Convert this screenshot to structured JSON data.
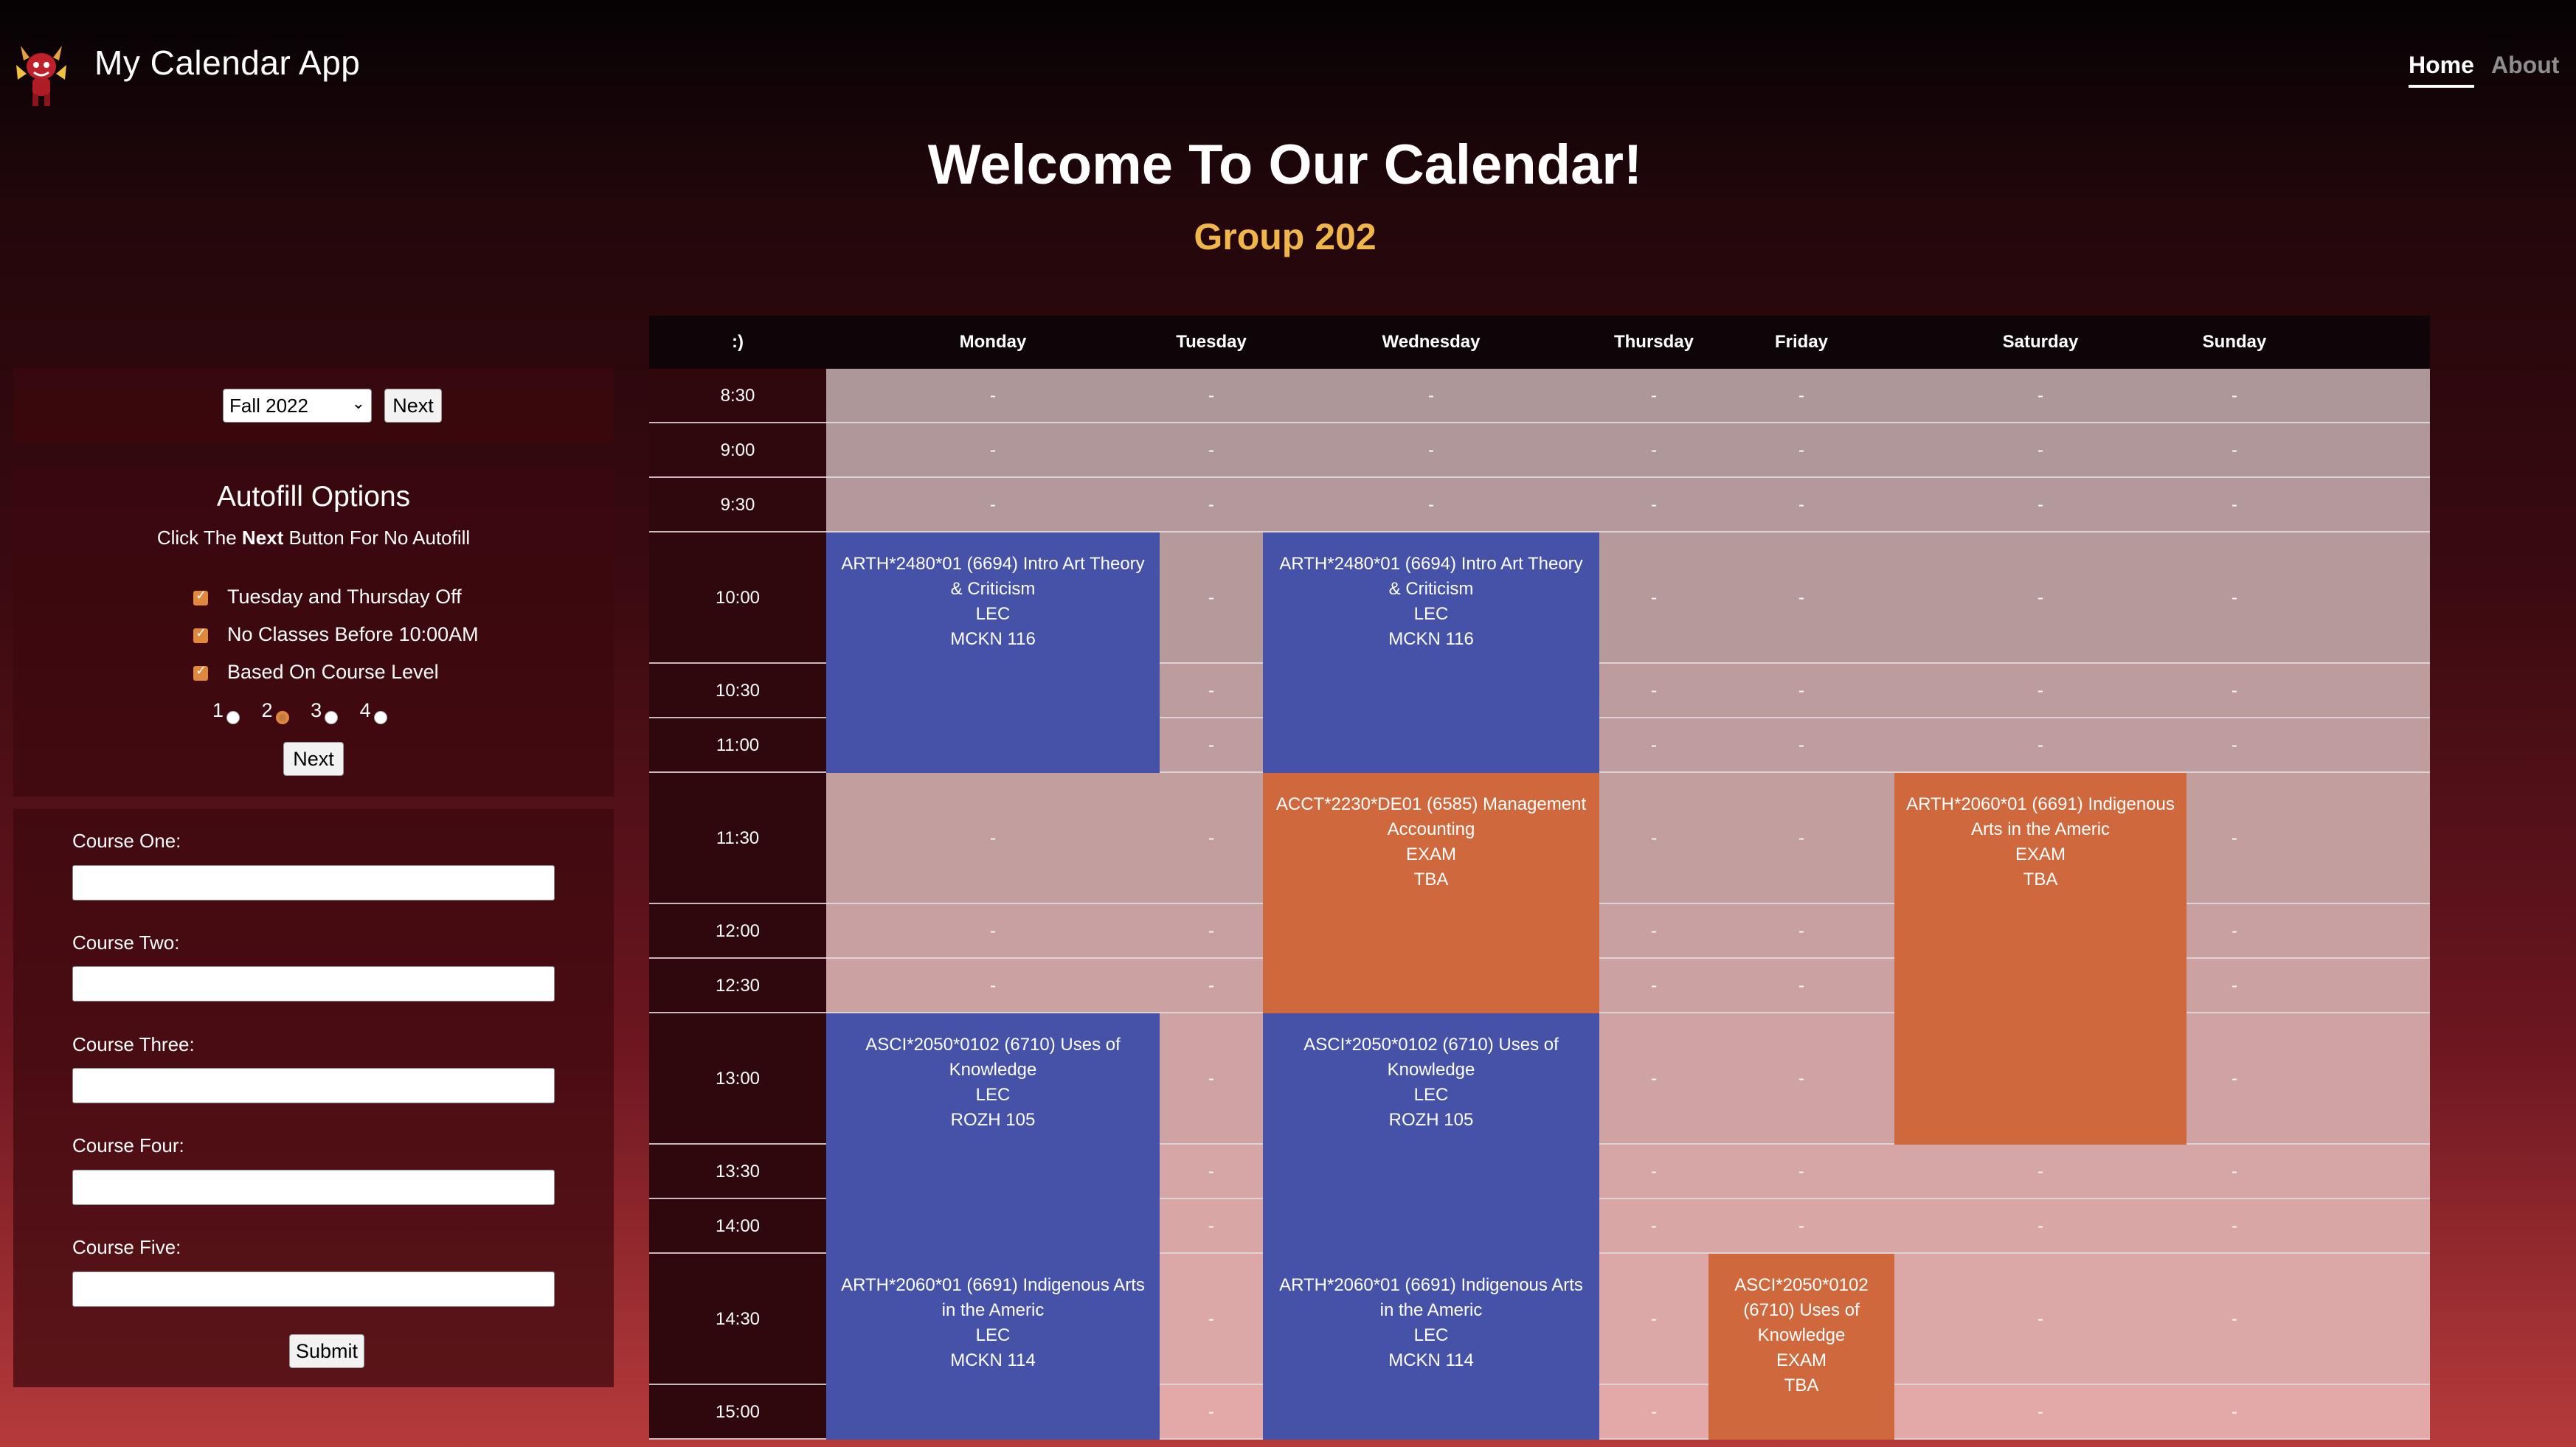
{
  "header": {
    "app_title": "My Calendar App",
    "nav": [
      {
        "label": "Home",
        "active": true
      },
      {
        "label": "About",
        "active": false
      }
    ]
  },
  "hero": {
    "title": "Welcome To Our Calendar!",
    "subtitle": "Group 202"
  },
  "term": {
    "selected": "Fall 2022",
    "next_label": "Next"
  },
  "autofill": {
    "title": "Autofill Options",
    "hint_prefix": "Click The ",
    "hint_bold": "Next",
    "hint_suffix": " Button For No Autofill",
    "options": [
      {
        "label": "Tuesday and Thursday Off",
        "checked": true
      },
      {
        "label": "No Classes Before 10:00AM",
        "checked": true
      },
      {
        "label": "Based On Course Level",
        "checked": true
      }
    ],
    "levels": [
      "1",
      "2",
      "3",
      "4"
    ],
    "selected_level": "2",
    "next_label": "Next"
  },
  "courses": {
    "fields": [
      {
        "label": "Course One:",
        "value": ""
      },
      {
        "label": "Course Two:",
        "value": ""
      },
      {
        "label": "Course Three:",
        "value": ""
      },
      {
        "label": "Course Four:",
        "value": ""
      },
      {
        "label": "Course Five:",
        "value": ""
      }
    ],
    "submit_label": "Submit"
  },
  "calendar": {
    "corner": ":)",
    "days": [
      "Monday",
      "Tuesday",
      "Wednesday",
      "Thursday",
      "Friday",
      "Saturday",
      "Sunday"
    ],
    "times": [
      "8:30",
      "9:00",
      "9:30",
      "10:00",
      "10:30",
      "11:00",
      "11:30",
      "12:00",
      "12:30",
      "13:00",
      "13:30",
      "14:00",
      "14:30",
      "15:00"
    ],
    "empty_marker": "-",
    "events": [
      {
        "day": 0,
        "start": 3,
        "span": 3,
        "color": "blue",
        "lines": [
          "ARTH*2480*01 (6694) Intro Art Theory & Criticism",
          "LEC",
          "MCKN 116"
        ]
      },
      {
        "day": 2,
        "start": 3,
        "span": 3,
        "color": "blue",
        "lines": [
          "ARTH*2480*01 (6694) Intro Art Theory & Criticism",
          "LEC",
          "MCKN 116"
        ]
      },
      {
        "day": 2,
        "start": 6,
        "span": 3,
        "color": "orange",
        "lines": [
          "ACCT*2230*DE01 (6585) Management Accounting",
          "EXAM",
          "TBA"
        ]
      },
      {
        "day": 5,
        "start": 6,
        "span": 4,
        "color": "orange",
        "lines": [
          "ARTH*2060*01 (6691) Indigenous Arts in the Americ",
          "EXAM",
          "TBA"
        ]
      },
      {
        "day": 0,
        "start": 9,
        "span": 3,
        "color": "blue",
        "lines": [
          "ASCI*2050*0102 (6710) Uses of Knowledge",
          "LEC",
          "ROZH 105"
        ]
      },
      {
        "day": 2,
        "start": 9,
        "span": 3,
        "color": "blue",
        "lines": [
          "ASCI*2050*0102 (6710) Uses of Knowledge",
          "LEC",
          "ROZH 105"
        ]
      },
      {
        "day": 0,
        "start": 12,
        "span": 2,
        "color": "blue",
        "lines": [
          "ARTH*2060*01 (6691) Indigenous Arts in the Americ",
          "LEC",
          "MCKN 114"
        ]
      },
      {
        "day": 2,
        "start": 12,
        "span": 2,
        "color": "blue",
        "lines": [
          "ARTH*2060*01 (6691) Indigenous Arts in the Americ",
          "LEC",
          "MCKN 114"
        ]
      },
      {
        "day": 4,
        "start": 12,
        "span": 2,
        "color": "orange",
        "lines": [
          "ASCI*2050*0102 (6710) Uses of Knowledge",
          "EXAM",
          "TBA"
        ]
      }
    ]
  }
}
